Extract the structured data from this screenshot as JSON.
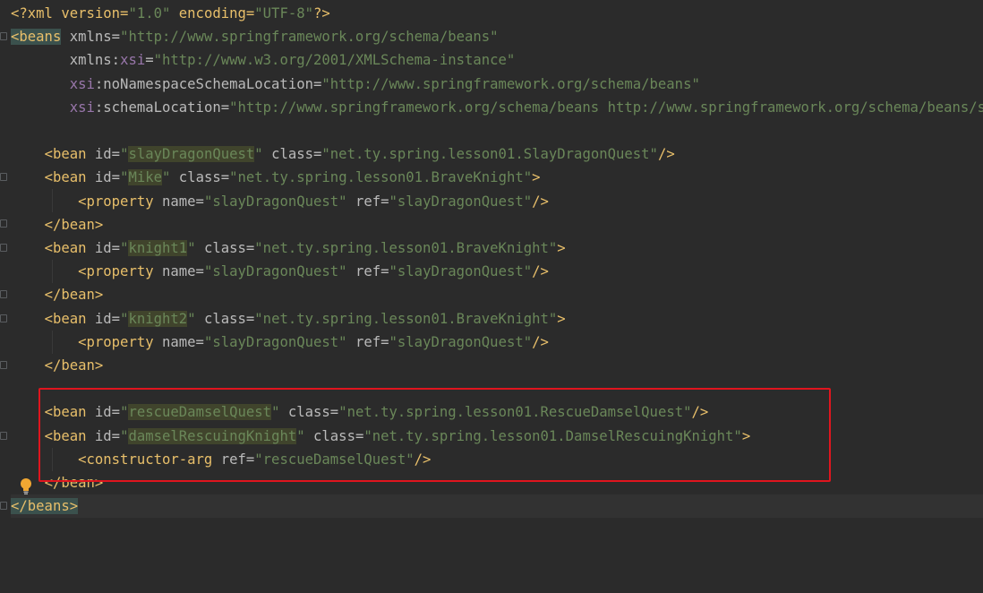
{
  "editor": {
    "lines": [
      {
        "segs": [
          [
            "pi",
            "<?xml version="
          ],
          [
            "v",
            "\"1.0\""
          ],
          [
            "pi",
            " encoding="
          ],
          [
            "v",
            "\"UTF-8\""
          ],
          [
            "pi",
            "?>"
          ]
        ]
      },
      {
        "segs": [
          [
            "tm",
            "<beans"
          ],
          [
            "a",
            " xmlns="
          ],
          [
            "v",
            "\"http://www.springframework.org/schema/beans\""
          ]
        ]
      },
      {
        "segs": [
          [
            "a",
            "       xmlns:"
          ],
          [
            "ns",
            "xsi"
          ],
          [
            "a",
            "="
          ],
          [
            "v",
            "\"http://www.w3.org/2001/XMLSchema-instance\""
          ]
        ]
      },
      {
        "segs": [
          [
            "a",
            "       "
          ],
          [
            "ns",
            "xsi"
          ],
          [
            "a",
            ":noNamespaceSchemaLocation="
          ],
          [
            "v",
            "\"http://www.springframework.org/schema/beans\""
          ]
        ]
      },
      {
        "segs": [
          [
            "a",
            "       "
          ],
          [
            "ns",
            "xsi"
          ],
          [
            "a",
            ":schemaLocation="
          ],
          [
            "v",
            "\"http://www.springframework.org/schema/beans http://www.springframework.org/schema/beans/spring-beans.xsd\""
          ]
        ]
      },
      {
        "segs": []
      },
      {
        "segs": [
          [
            "a",
            "    "
          ],
          [
            "t",
            "<bean "
          ],
          [
            "a",
            "id="
          ],
          [
            "v",
            "\""
          ],
          [
            "vh",
            "slayDragonQuest"
          ],
          [
            "v",
            "\""
          ],
          [
            "a",
            " class="
          ],
          [
            "v",
            "\"net.ty.spring.lesson01.SlayDragonQuest\""
          ],
          [
            "t",
            "/>"
          ]
        ]
      },
      {
        "segs": [
          [
            "a",
            "    "
          ],
          [
            "t",
            "<bean "
          ],
          [
            "a",
            "id="
          ],
          [
            "v",
            "\""
          ],
          [
            "vh",
            "Mike"
          ],
          [
            "v",
            "\""
          ],
          [
            "a",
            " class="
          ],
          [
            "v",
            "\"net.ty.spring.lesson01.BraveKnight\""
          ],
          [
            "t",
            ">"
          ]
        ]
      },
      {
        "segs": [
          [
            "a",
            "        "
          ],
          [
            "t",
            "<property "
          ],
          [
            "a",
            "name="
          ],
          [
            "v",
            "\"slayDragonQuest\""
          ],
          [
            "a",
            " ref="
          ],
          [
            "v",
            "\"slayDragonQuest\""
          ],
          [
            "t",
            "/>"
          ]
        ]
      },
      {
        "segs": [
          [
            "a",
            "    "
          ],
          [
            "t",
            "</bean>"
          ]
        ]
      },
      {
        "segs": [
          [
            "a",
            "    "
          ],
          [
            "t",
            "<bean "
          ],
          [
            "a",
            "id="
          ],
          [
            "v",
            "\""
          ],
          [
            "vh",
            "knight1"
          ],
          [
            "v",
            "\""
          ],
          [
            "a",
            " class="
          ],
          [
            "v",
            "\"net.ty.spring.lesson01.BraveKnight\""
          ],
          [
            "t",
            ">"
          ]
        ]
      },
      {
        "segs": [
          [
            "a",
            "        "
          ],
          [
            "t",
            "<property "
          ],
          [
            "a",
            "name="
          ],
          [
            "v",
            "\"slayDragonQuest\""
          ],
          [
            "a",
            " ref="
          ],
          [
            "v",
            "\"slayDragonQuest\""
          ],
          [
            "t",
            "/>"
          ]
        ]
      },
      {
        "segs": [
          [
            "a",
            "    "
          ],
          [
            "t",
            "</bean>"
          ]
        ]
      },
      {
        "segs": [
          [
            "a",
            "    "
          ],
          [
            "t",
            "<bean "
          ],
          [
            "a",
            "id="
          ],
          [
            "v",
            "\""
          ],
          [
            "vh",
            "knight2"
          ],
          [
            "v",
            "\""
          ],
          [
            "a",
            " class="
          ],
          [
            "v",
            "\"net.ty.spring.lesson01.BraveKnight\""
          ],
          [
            "t",
            ">"
          ]
        ]
      },
      {
        "segs": [
          [
            "a",
            "        "
          ],
          [
            "t",
            "<property "
          ],
          [
            "a",
            "name="
          ],
          [
            "v",
            "\"slayDragonQuest\""
          ],
          [
            "a",
            " ref="
          ],
          [
            "v",
            "\"slayDragonQuest\""
          ],
          [
            "t",
            "/>"
          ]
        ]
      },
      {
        "segs": [
          [
            "a",
            "    "
          ],
          [
            "t",
            "</bean>"
          ]
        ]
      },
      {
        "segs": []
      },
      {
        "segs": [
          [
            "a",
            "    "
          ],
          [
            "t",
            "<bean "
          ],
          [
            "a",
            "id="
          ],
          [
            "v",
            "\""
          ],
          [
            "vh",
            "rescueDamselQuest"
          ],
          [
            "v",
            "\""
          ],
          [
            "a",
            " class="
          ],
          [
            "v",
            "\"net.ty.spring.lesson01.RescueDamselQuest\""
          ],
          [
            "t",
            "/>"
          ]
        ]
      },
      {
        "segs": [
          [
            "a",
            "    "
          ],
          [
            "t",
            "<bean "
          ],
          [
            "a",
            "id="
          ],
          [
            "v",
            "\""
          ],
          [
            "vh",
            "damselRescuingKnight"
          ],
          [
            "v",
            "\""
          ],
          [
            "a",
            " class="
          ],
          [
            "v",
            "\"net.ty.spring.lesson01.DamselRescuingKnight\""
          ],
          [
            "t",
            ">"
          ]
        ]
      },
      {
        "segs": [
          [
            "a",
            "        "
          ],
          [
            "t",
            "<constructor-arg "
          ],
          [
            "a",
            "ref="
          ],
          [
            "v",
            "\"rescueDamselQuest\""
          ],
          [
            "t",
            "/>"
          ]
        ]
      },
      {
        "segs": [
          [
            "a",
            "    "
          ],
          [
            "t",
            "</bean>"
          ]
        ]
      },
      {
        "segs": [
          [
            "tm",
            "</beans>"
          ]
        ],
        "current": true
      }
    ]
  }
}
